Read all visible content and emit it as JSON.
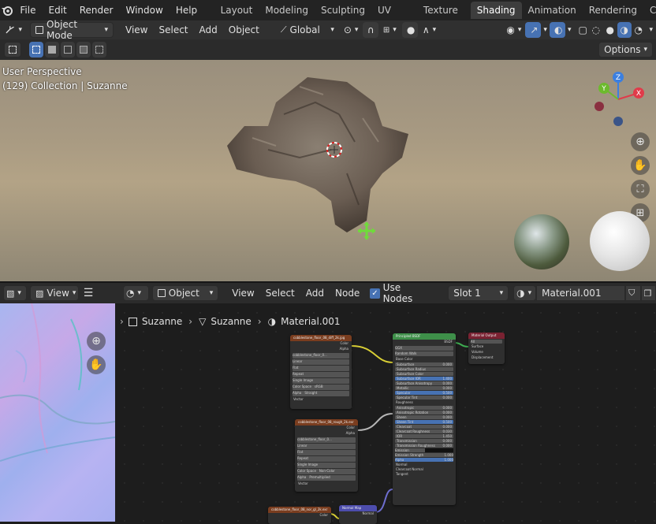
{
  "topmenu": {
    "items": [
      "File",
      "Edit",
      "Render",
      "Window",
      "Help"
    ]
  },
  "workspaces": {
    "tabs": [
      "Layout",
      "Modeling",
      "Sculpting",
      "UV Editing",
      "Texture Paint",
      "Shading",
      "Animation",
      "Rendering",
      "Compo"
    ],
    "active": "Shading"
  },
  "viewport_header": {
    "mode": "Object Mode",
    "menus": [
      "View",
      "Select",
      "Add",
      "Object"
    ],
    "transform": "Global",
    "options": "Options"
  },
  "viewport": {
    "perspective": "User Perspective",
    "collection": "(129) Collection | Suzanne",
    "gizmo": {
      "x": "X",
      "y": "Y",
      "z": "Z"
    }
  },
  "image_header": {
    "view": "View"
  },
  "node_header": {
    "object": "Object",
    "menus": [
      "View",
      "Select",
      "Add",
      "Node"
    ],
    "use_nodes": "Use Nodes",
    "slot": "Slot 1",
    "material": "Material.001"
  },
  "breadcrumb": {
    "items": [
      "Suzanne",
      "Suzanne",
      "Material.001"
    ]
  },
  "colors": {
    "accent": "#4772b3",
    "active_tab": "#3d3d3d",
    "header": "#2b2b2b",
    "node_header_texture": "#7a3d1f",
    "node_header_shader": "#3e8f49",
    "node_header_output": "#7a2232",
    "node_header_vector": "#4d4dad"
  },
  "nodes": {
    "tex1": {
      "title": "cobblestone_floor_08_diff_2k.jpg",
      "outputs": [
        "Color",
        "Alpha"
      ],
      "file": "cobblestone_floor_0...",
      "rows": [
        "Linear",
        "Flat",
        "Repeat",
        "Single Image"
      ],
      "colorspace_label": "Color Space",
      "colorspace": "sRGB",
      "alpha_label": "Alpha",
      "alpha": "Straight",
      "vector": "Vector"
    },
    "tex2": {
      "title": "cobblestone_floor_08_rough_2k.exr",
      "outputs": [
        "Color",
        "Alpha"
      ],
      "file": "cobblestone_floor_0...",
      "rows": [
        "Linear",
        "Flat",
        "Repeat",
        "Single Image"
      ],
      "colorspace_label": "Color Space",
      "colorspace": "Non-Color",
      "alpha_label": "Alpha",
      "alpha": "Premultiplied",
      "vector": "Vector"
    },
    "tex3": {
      "title": "cobblestone_floor_08_nor_gl_2k.exr",
      "output": "Color"
    },
    "bsdf": {
      "title": "Principled BSDF",
      "output": "BSDF",
      "distribution": "GGX",
      "subsurface_method": "Random Walk",
      "socket_base": "Base Color",
      "rows": [
        [
          "Subsurface",
          "0.000"
        ],
        [
          "Subsurface Radius",
          ""
        ],
        [
          "Subsurface Color",
          ""
        ],
        [
          "Subsurface IOR",
          "1.400"
        ],
        [
          "Subsurface Anisotropy",
          "0.000"
        ],
        [
          "Metallic",
          "0.000"
        ],
        [
          "Specular",
          "0.500"
        ],
        [
          "Specular Tint",
          "0.000"
        ]
      ],
      "socket_roughness": "Roughness",
      "rows2": [
        [
          "Anisotropic",
          "0.000"
        ],
        [
          "Anisotropic Rotation",
          "0.000"
        ],
        [
          "Sheen",
          "0.000"
        ],
        [
          "Sheen Tint",
          "0.500"
        ],
        [
          "Clearcoat",
          "0.000"
        ],
        [
          "Clearcoat Roughness",
          "0.030"
        ],
        [
          "IOR",
          "1.450"
        ],
        [
          "Transmission",
          "0.000"
        ],
        [
          "Transmission Roughness",
          "0.000"
        ]
      ],
      "socket_emission": "Emission",
      "emission_strength": [
        "Emission Strength",
        "1.000"
      ],
      "alpha": [
        "Alpha",
        "1.000"
      ],
      "sockets_bottom": [
        "Normal",
        "Clearcoat Normal",
        "Tangent"
      ]
    },
    "output": {
      "title": "Material Output",
      "target": "All",
      "sockets": [
        "Surface",
        "Volume",
        "Displacement"
      ]
    },
    "normalmap": {
      "title": "Normal Map",
      "output": "Normal"
    }
  }
}
